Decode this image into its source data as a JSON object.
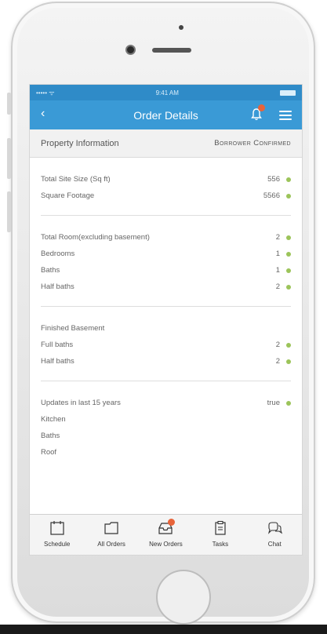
{
  "status_bar": {
    "signal": "•••••  ᯤ",
    "time": "9:41 AM"
  },
  "nav": {
    "back": "‹",
    "title": "Order Details"
  },
  "info_bar": {
    "title": "Property Information",
    "status": "Borrower Confirmed"
  },
  "sections": [
    {
      "rows": [
        {
          "label": "Total Site Size (Sq ft)",
          "value": "556"
        },
        {
          "label": "Square Footage",
          "value": "5566"
        }
      ]
    },
    {
      "rows": [
        {
          "label": "Total Room(excluding basement)",
          "value": "2"
        },
        {
          "label": "Bedrooms",
          "value": "1"
        },
        {
          "label": "Baths",
          "value": "1"
        },
        {
          "label": "Half baths",
          "value": "2"
        }
      ]
    },
    {
      "rows": [
        {
          "label": "Finished Basement",
          "value": ""
        },
        {
          "label": "Full baths",
          "value": "2"
        },
        {
          "label": "Half baths",
          "value": "2"
        }
      ]
    }
  ],
  "updates": {
    "label": "Updates in last 15 years",
    "value": "true",
    "items": [
      "Kitchen",
      "Baths",
      "Roof"
    ]
  },
  "tabs": [
    {
      "label": "Schedule",
      "icon": "calendar-icon"
    },
    {
      "label": "All Orders",
      "icon": "folder-icon"
    },
    {
      "label": "New Orders",
      "icon": "inbox-icon"
    },
    {
      "label": "Tasks",
      "icon": "clipboard-icon"
    },
    {
      "label": "Chat",
      "icon": "chat-icon"
    }
  ],
  "colors": {
    "header": "#3a9ad6",
    "status_dot": "#9cc45a",
    "badge": "#e8643a"
  }
}
